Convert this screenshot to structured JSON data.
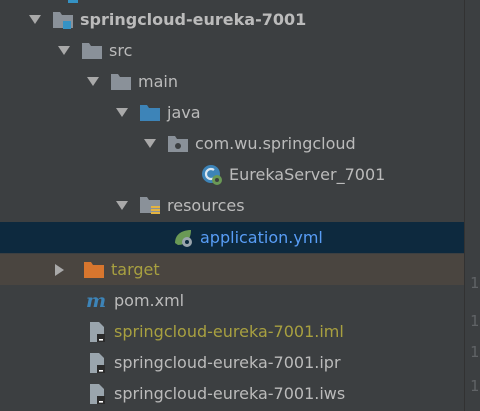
{
  "tree": {
    "items": [
      {
        "label": "springcloud-eureka-7001",
        "icon": "module-folder-icon",
        "expanded": true
      },
      {
        "label": "src",
        "icon": "folder-icon",
        "expanded": true
      },
      {
        "label": "main",
        "icon": "folder-icon",
        "expanded": true
      },
      {
        "label": "java",
        "icon": "source-root-folder-icon",
        "expanded": true
      },
      {
        "label": "com.wu.springcloud",
        "icon": "package-icon",
        "expanded": true
      },
      {
        "label": "EurekaServer_7001",
        "icon": "spring-boot-class-icon"
      },
      {
        "label": "resources",
        "icon": "resources-folder-icon",
        "expanded": true
      },
      {
        "label": "application.yml",
        "icon": "spring-yml-icon",
        "selected": true
      },
      {
        "label": "target",
        "icon": "excluded-folder-icon",
        "expanded": false
      },
      {
        "label": "pom.xml",
        "icon": "maven-icon"
      },
      {
        "label": "springcloud-eureka-7001.iml",
        "icon": "iml-file-icon"
      },
      {
        "label": "springcloud-eureka-7001.ipr",
        "icon": "ipr-file-icon"
      },
      {
        "label": "springcloud-eureka-7001.iws",
        "icon": "iws-file-icon"
      }
    ]
  },
  "gutter": {
    "digits": [
      "1",
      "1",
      "1",
      "1"
    ]
  },
  "colors": {
    "background": "#3c3f41",
    "selection": "#0d293e",
    "excluded_row": "#4a4540",
    "text": "#bbbbbb",
    "selected_text": "#589df6",
    "excluded_text": "#a8a040",
    "folder": "#8a9199",
    "source_folder": "#3d84b8",
    "excluded_folder": "#d8762e"
  }
}
